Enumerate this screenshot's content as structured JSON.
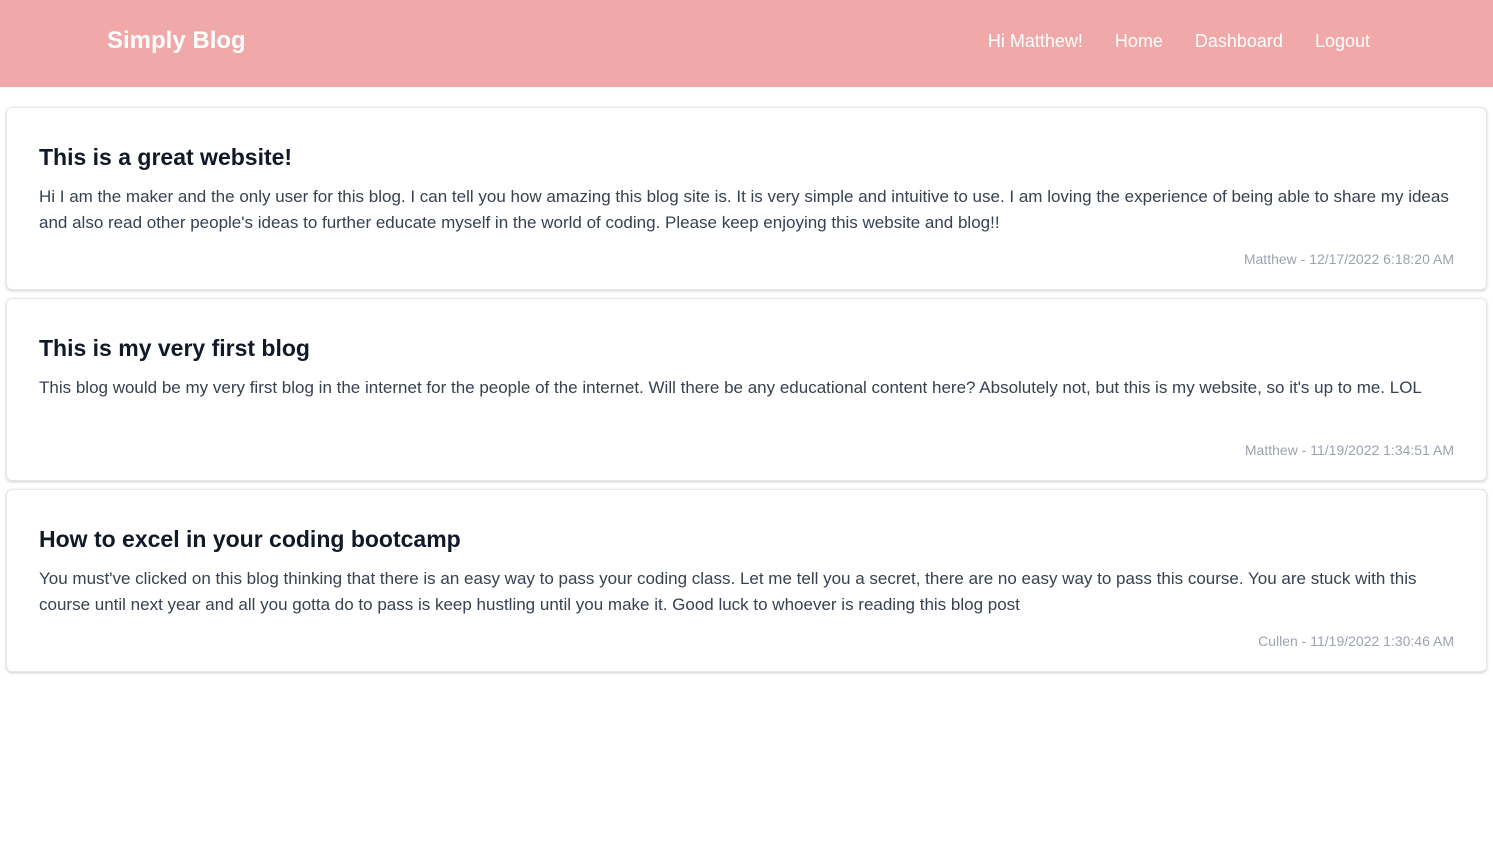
{
  "nav": {
    "brand": "Simply Blog",
    "greeting": "Hi Matthew!",
    "links": [
      "Home",
      "Dashboard",
      "Logout"
    ]
  },
  "posts": [
    {
      "title": "This is a great website!",
      "body": "Hi I am the maker and the only user for this blog. I can tell you how amazing this blog site is. It is very simple and intuitive to use. I am loving the experience of being able to share my ideas and also read other people's ideas to further educate myself in the world of coding. Please keep enjoying this website and blog!!",
      "meta": "Matthew - 12/17/2022 6:18:20 AM"
    },
    {
      "title": "This is my very first blog",
      "body": "This blog would be my very first blog in the internet for the people of the internet. Will there be any educational content here? Absolutely not, but this is my website, so it's up to me. LOL",
      "meta": "Matthew - 11/19/2022 1:34:51 AM"
    },
    {
      "title": "How to excel in your coding bootcamp",
      "body": "You must've clicked on this blog thinking that there is an easy way to pass your coding class. Let me tell you a secret, there are no easy way to pass this course. You are stuck with this course until next year and all you gotta do to pass is keep hustling until you make it. Good luck to whoever is reading this blog post",
      "meta": "Cullen - 11/19/2022 1:30:46 AM"
    }
  ],
  "colors": {
    "navbar": "#f0a9a8",
    "title": "#111827",
    "body": "#374151",
    "meta": "#9ca3af"
  }
}
